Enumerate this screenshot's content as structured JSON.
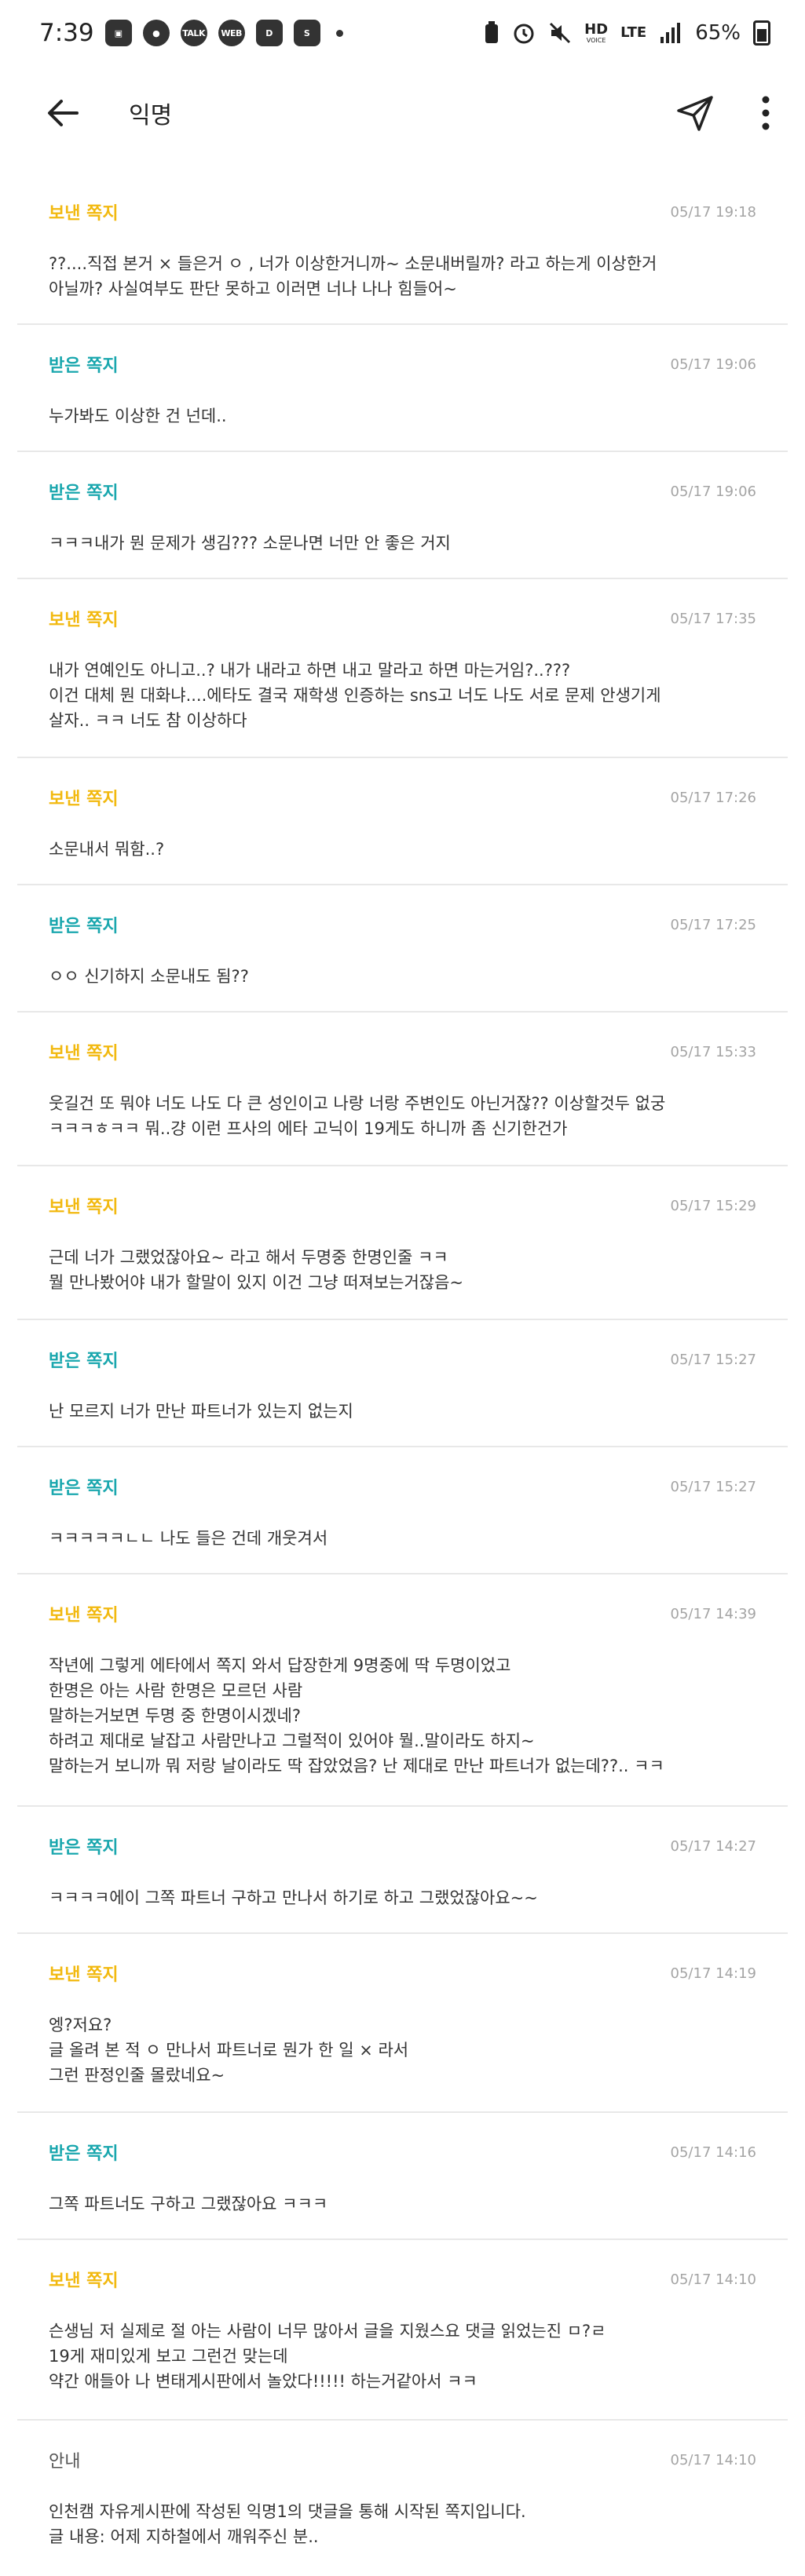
{
  "status_bar": {
    "time": "7:39",
    "app_icons": [
      "gallery-icon",
      "chat-icon",
      "talk-icon",
      "webtoon-icon",
      "daily-icon",
      "s-icon"
    ],
    "hd_label": "HD",
    "voice_label": "VOICE",
    "lte_label": "LTE",
    "battery": "65%"
  },
  "header": {
    "title": "익명"
  },
  "messages": [
    {
      "type": "보낸 쪽지",
      "kind": "sent",
      "date": "05/17 19:18",
      "body": "??....직접 본거 × 들은거 ㅇ , 너가 이상한거니까~ 소문내버릴까? 라고 하는게 이상한거\n아닐까? 사실여부도 판단 못하고 이러면 너나 나나 힘들어~"
    },
    {
      "type": "받은 쪽지",
      "kind": "recv",
      "date": "05/17 19:06",
      "body": "누가봐도 이상한 건 넌데.."
    },
    {
      "type": "받은 쪽지",
      "kind": "recv",
      "date": "05/17 19:06",
      "body": "ㅋㅋㅋ내가 뭔 문제가 생김??? 소문나면 너만 안 좋은 거지"
    },
    {
      "type": "보낸 쪽지",
      "kind": "sent",
      "date": "05/17 17:35",
      "body": "내가 연예인도 아니고..? 내가 내라고 하면 내고 말라고 하면 마는거임?..???\n이건 대체 뭔 대화냐....에타도 결국 재학생 인증하는 sns고 너도 나도 서로 문제 안생기게\n살자.. ㅋㅋ 너도 참 이상하다"
    },
    {
      "type": "보낸 쪽지",
      "kind": "sent",
      "date": "05/17 17:26",
      "body": "소문내서 뭐함..?"
    },
    {
      "type": "받은 쪽지",
      "kind": "recv",
      "date": "05/17 17:25",
      "body": "ㅇㅇ 신기하지 소문내도 됨??"
    },
    {
      "type": "보낸 쪽지",
      "kind": "sent",
      "date": "05/17 15:33",
      "body": "웃길건 또 뭐야 너도 나도 다 큰 성인이고 나랑 너랑 주변인도 아닌거잖?? 이상할것두 없궁\nㅋㅋㅋㅎㅋㅋ 뭐..걍 이런 프사의 에타 고닉이 19게도 하니까 좀 신기한건가"
    },
    {
      "type": "보낸 쪽지",
      "kind": "sent",
      "date": "05/17 15:29",
      "body": "근데 너가 그랬었잖아요~ 라고 해서 두명중 한명인줄 ㅋㅋ\n뭘 만나봤어야 내가 할말이 있지 이건 그냥 떠져보는거잖음~"
    },
    {
      "type": "받은 쪽지",
      "kind": "recv",
      "date": "05/17 15:27",
      "body": "난 모르지 너가 만난 파트너가 있는지 없는지"
    },
    {
      "type": "받은 쪽지",
      "kind": "recv",
      "date": "05/17 15:27",
      "body": "ㅋㅋㅋㅋㅋㄴㄴ 나도 들은 건데 개웃겨서"
    },
    {
      "type": "보낸 쪽지",
      "kind": "sent",
      "date": "05/17 14:39",
      "body": "작년에 그렇게 에타에서 쪽지 와서 답장한게 9명중에 딱 두명이었고\n한명은 아는 사람 한명은 모르던 사람\n말하는거보면 두명 중 한명이시겠네?\n하려고 제대로 날잡고 사람만나고 그럴적이 있어야 뭘..말이라도 하지~\n말하는거 보니까 뭐 저랑 날이라도 딱 잡았었음? 난 제대로 만난 파트너가 없는데??.. ㅋㅋ"
    },
    {
      "type": "받은 쪽지",
      "kind": "recv",
      "date": "05/17 14:27",
      "body": "ㅋㅋㅋㅋ에이 그쪽 파트너 구하고 만나서 하기로 하고 그랬었잖아요~~"
    },
    {
      "type": "보낸 쪽지",
      "kind": "sent",
      "date": "05/17 14:19",
      "body": "엥?저요?\n글 올려 본 적 ㅇ 만나서 파트너로 뭔가 한 일 × 라서\n그런 판정인줄 몰랐네요~"
    },
    {
      "type": "받은 쪽지",
      "kind": "recv",
      "date": "05/17 14:16",
      "body": "그쪽 파트너도 구하고 그랬잖아요 ㅋㅋㅋ"
    },
    {
      "type": "보낸 쪽지",
      "kind": "sent",
      "date": "05/17 14:10",
      "body": "슨생님 저 실제로 절 아는 사람이 너무 많아서 글을 지웠스요 댓글 읽었는진 ㅁ?ㄹ\n19게 재미있게 보고 그런건 맞는데\n약간 애들아 나 변태게시판에서 놀았다!!!!! 하는거같아서 ㅋㅋ"
    },
    {
      "type": "안내",
      "kind": "info",
      "date": "05/17 14:10",
      "body": "인천캠 자유게시판에 작성된 익명1의 댓글을 통해 시작된 쪽지입니다.\n글 내용: 어제 지하철에서 깨워주신 분.."
    }
  ]
}
